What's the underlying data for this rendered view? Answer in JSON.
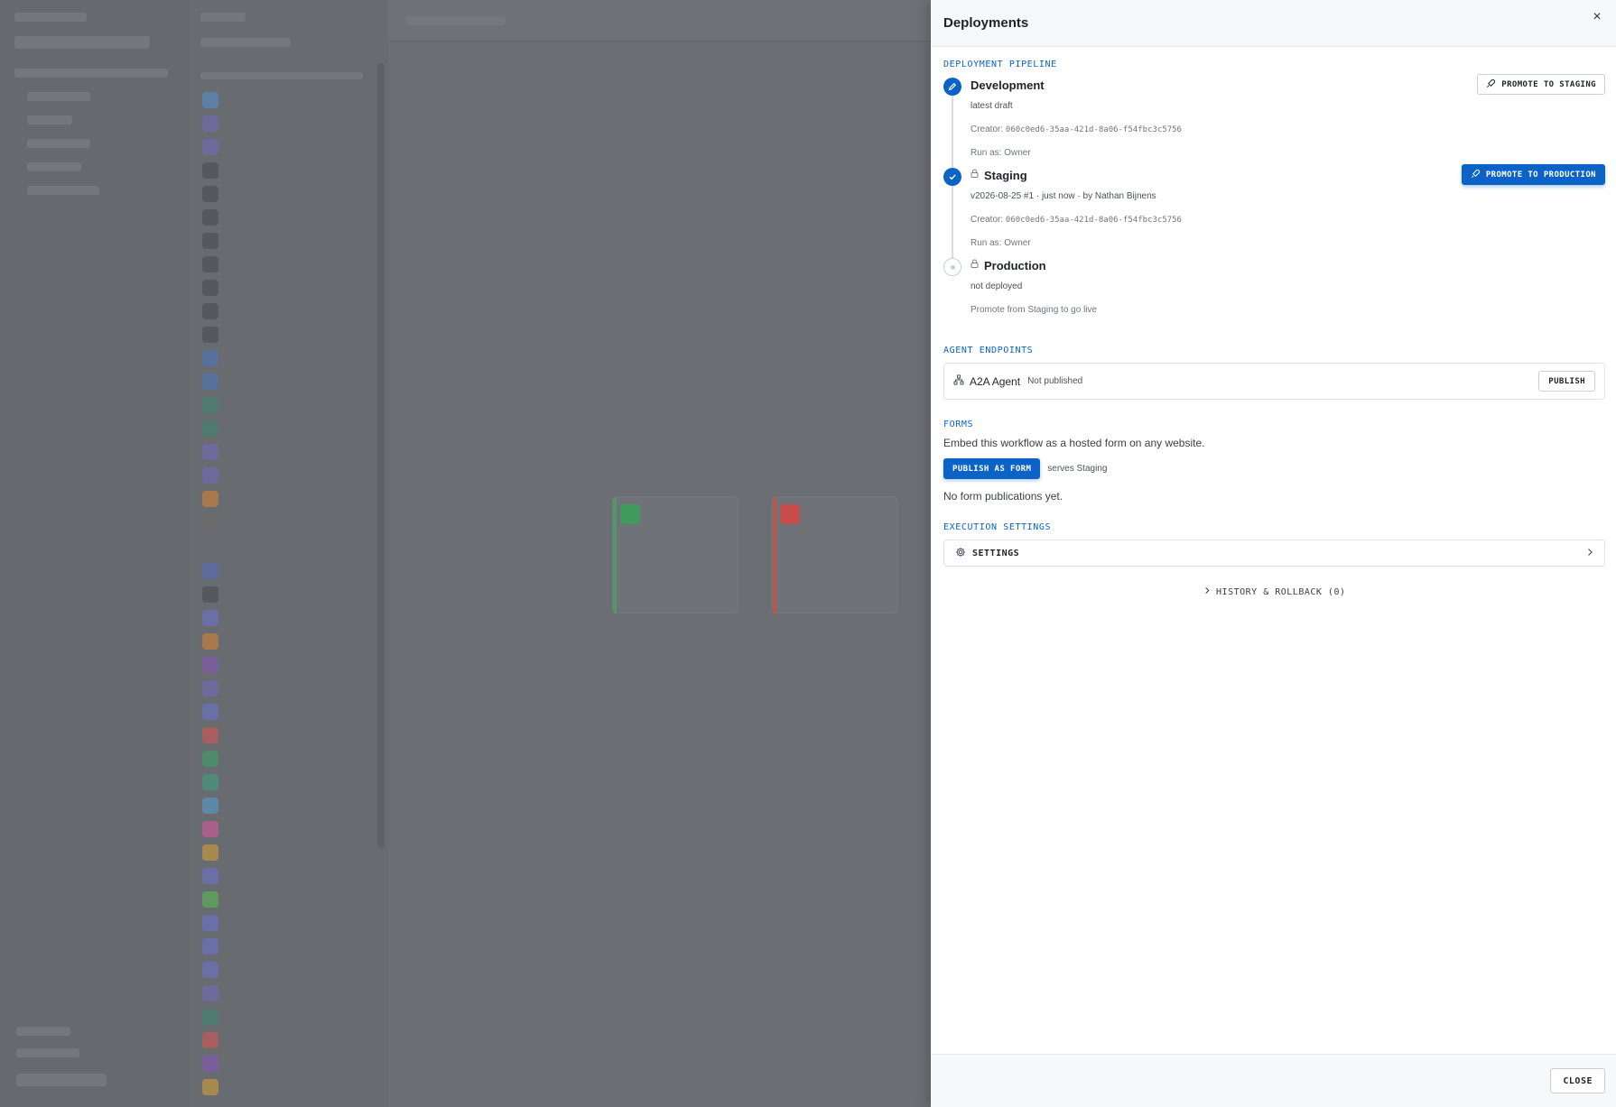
{
  "panel": {
    "title": "Deployments",
    "close_glyph": "×"
  },
  "pipeline": {
    "label": "Deployment pipeline",
    "stages": [
      {
        "name": "Development",
        "line1": "latest draft",
        "creator_prefix": "Creator:",
        "creator_id": "060c0ed6-35aa-421d-8a06-f54fbc3c5756",
        "run_as": "Run as: Owner",
        "action": "PROMOTE TO STAGING",
        "icon": "pencil-icon"
      },
      {
        "name": "Staging",
        "line1": "v2026-08-25 #1 · just now · by Nathan Bijnens",
        "creator_prefix": "Creator:",
        "creator_id": "060c0ed6-35aa-421d-8a06-f54fbc3c5756",
        "run_as": "Run as: Owner",
        "action": "PROMOTE TO PRODUCTION",
        "icon": "check-icon"
      },
      {
        "name": "Production",
        "line1": "not deployed",
        "note": "Promote from Staging to go live",
        "icon": "empty-dot-icon"
      }
    ]
  },
  "endpoints": {
    "label": "Agent endpoints",
    "name": "A2A Agent",
    "status": "Not published",
    "action": "PUBLISH",
    "icon": "network-icon"
  },
  "forms": {
    "label": "Forms",
    "description": "Embed this workflow as a hosted form on any website.",
    "action": "PUBLISH AS FORM",
    "serves": "serves Staging",
    "empty": "No form publications yet."
  },
  "execution": {
    "label": "Execution settings",
    "settings_label": "SETTINGS",
    "icon": "gear-icon"
  },
  "history": {
    "label": "HISTORY & ROLLBACK (0)"
  },
  "footer": {
    "close_label": "CLOSE"
  },
  "colors": {
    "accent": "#0b63c8",
    "overlay": "#6a6d72"
  }
}
